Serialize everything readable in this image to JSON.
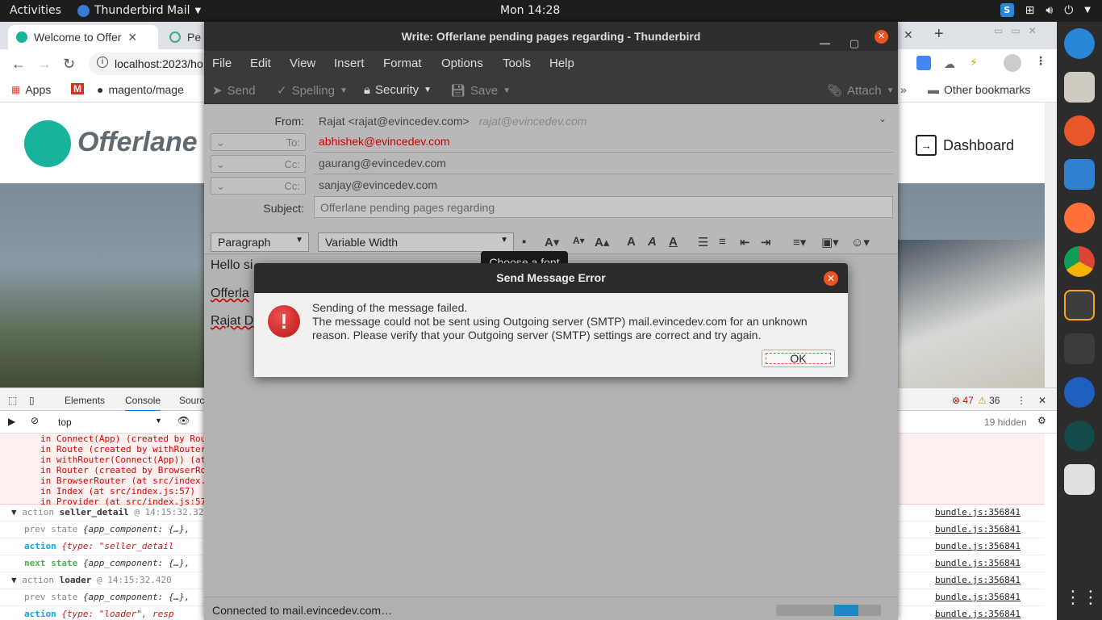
{
  "topbar": {
    "activities": "Activities",
    "app_name": "Thunderbird Mail",
    "clock": "Mon 14:28"
  },
  "chrome": {
    "tabs": [
      {
        "title": "Welcome to Offer"
      },
      {
        "title": "Pe"
      }
    ],
    "url": "localhost:2023/ho",
    "bookmarks": {
      "apps": "Apps",
      "magento": "magento/mage",
      "other": "Other bookmarks"
    },
    "site": {
      "logo_text": "Offerlane",
      "dashboard_label": "Dashboard"
    }
  },
  "devtools": {
    "tabs": [
      "Elements",
      "Console",
      "Sourc"
    ],
    "context": "top",
    "errors_count": "47",
    "warnings_count": "36",
    "hidden_label": "19 hidden",
    "error_lines": [
      "in Connect(App) (created by Rou",
      "in Route (created by withRouter",
      "in withRouter(Connect(App)) (at",
      "in Router (created by BrowserRo",
      "in BrowserRouter (at src/index.",
      "in Index (at src/index.js:57)",
      "in Provider (at src/index.js:57"
    ],
    "rows": [
      {
        "label": "action",
        "name": "seller_detail",
        "meta": "@ 14:15:32.32",
        "src": "bundle.js:356841"
      },
      {
        "label": "prev state",
        "value": "{app_component: {…},",
        "src": "bundle.js:356841"
      },
      {
        "label": "action",
        "value": "{type: \"seller_detail",
        "src": "bundle.js:356841"
      },
      {
        "label": "next state",
        "value": "{app_component: {…},",
        "src": "bundle.js:356841"
      },
      {
        "label": "action",
        "name": "loader",
        "meta": "@ 14:15:32.420",
        "src": "bundle.js:356841"
      },
      {
        "label": "prev state",
        "value": "{app_component: {…},",
        "src": "bundle.js:356841"
      },
      {
        "label": "action",
        "value": "{type: \"loader\", resp",
        "src": "bundle.js:356841"
      }
    ]
  },
  "compose": {
    "window_title": "Write: Offerlane pending pages regarding - Thunderbird",
    "menu": [
      "File",
      "Edit",
      "View",
      "Insert",
      "Format",
      "Options",
      "Tools",
      "Help"
    ],
    "toolbar": {
      "send": "Send",
      "spelling": "Spelling",
      "security": "Security",
      "save": "Save",
      "attach": "Attach"
    },
    "from_label": "From:",
    "from_value": "Rajat <rajat@evincedev.com>",
    "from_identity": "rajat@evincedev.com",
    "to_label": "To:",
    "to_value": "abhishek@evincedev.com",
    "cc_label": "Cc:",
    "cc1_value": "gaurang@evincedev.com",
    "cc2_value": "sanjay@evincedev.com",
    "subject_label": "Subject:",
    "subject_value": "Offerlane pending pages regarding",
    "paragraph_format": "Paragraph",
    "font": "Variable Width",
    "body_lines": [
      "Hello si",
      "Offerla",
      "Rajat D"
    ],
    "status": "Connected to mail.evincedev.com…",
    "progress_fraction": 0.23
  },
  "tooltip": "Choose a font",
  "dialog": {
    "title": "Send Message Error",
    "line1": "Sending of the message failed.",
    "line2": "The message could not be sent using Outgoing server (SMTP) mail.evincedev.com for an unknown",
    "line3": "reason. Please verify that your Outgoing server (SMTP) settings are correct and try again.",
    "ok_label": "OK"
  }
}
